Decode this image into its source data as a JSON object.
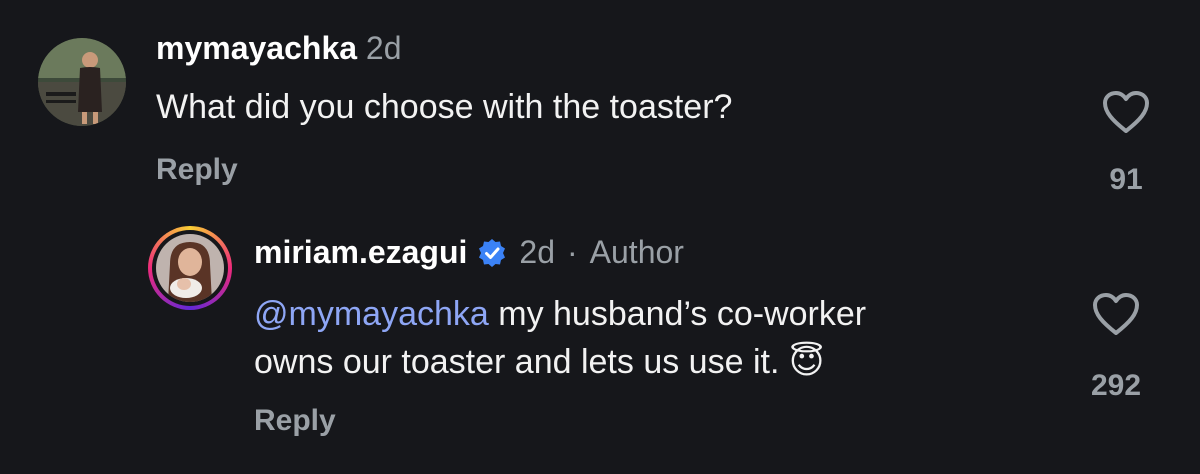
{
  "comments": [
    {
      "username": "mymayachka",
      "time": "2d",
      "text": "What did you choose with the toaster?",
      "reply_label": "Reply",
      "like_count": "91"
    }
  ],
  "reply": {
    "username": "miriam.ezagui",
    "time": "2d",
    "separator": "·",
    "author_badge": "Author",
    "mention": "@mymayachka",
    "text_line1": " my husband’s co-worker",
    "text_line2": "owns our toaster and lets us use it. ",
    "emoji": "😇",
    "reply_label": "Reply",
    "like_count": "292"
  },
  "colors": {
    "background": "#16171b",
    "mention": "#8ea6f5",
    "verified": "#3b82f6",
    "muted": "#9aa0a6"
  }
}
